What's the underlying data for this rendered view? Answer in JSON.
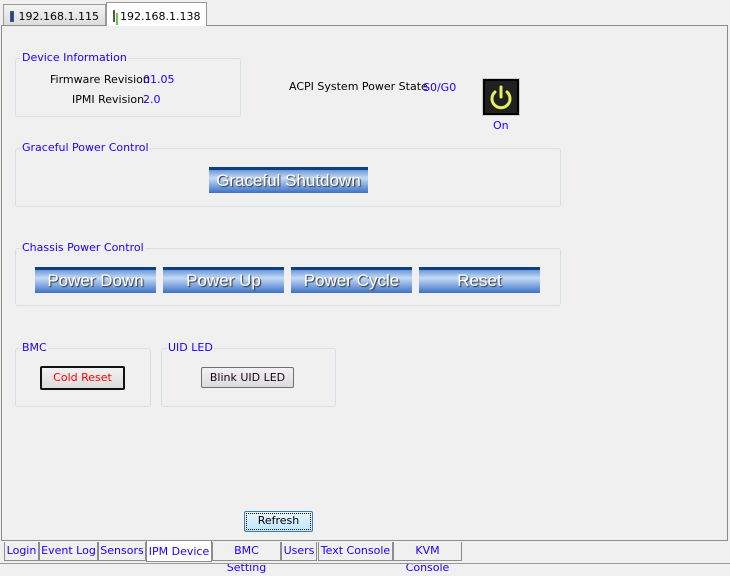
{
  "top_tabs": [
    {
      "label": "192.168.1.115",
      "icon": "monitor-icon"
    },
    {
      "label": "192.168.1.138",
      "icon": "network-monitor-icon"
    }
  ],
  "device_info": {
    "title": "Device Information",
    "firmware_label": "Firmware Revision",
    "firmware_value": "01.05",
    "ipmi_label": "IPMI Revision",
    "ipmi_value": "2.0"
  },
  "acpi": {
    "label": "ACPI System Power State",
    "value": "S0/G0",
    "power_status": "On"
  },
  "graceful": {
    "title": "Graceful Power Control",
    "shutdown_label": "Graceful Shutdown"
  },
  "chassis": {
    "title": "Chassis Power Control",
    "buttons": [
      "Power Down",
      "Power Up",
      "Power Cycle",
      "Reset"
    ]
  },
  "bmc": {
    "title": "BMC",
    "cold_reset_label": "Cold Reset"
  },
  "uid": {
    "title": "UID LED",
    "blink_label": "Blink UID LED"
  },
  "refresh_label": "Refresh",
  "bottom_tabs": [
    "Login",
    "Event Log",
    "Sensors",
    "IPM Device",
    "BMC Setting",
    "Users",
    "Text Console",
    "KVM Console"
  ],
  "colors": {
    "accent": "#1a00ff",
    "danger": "#ff0000"
  }
}
